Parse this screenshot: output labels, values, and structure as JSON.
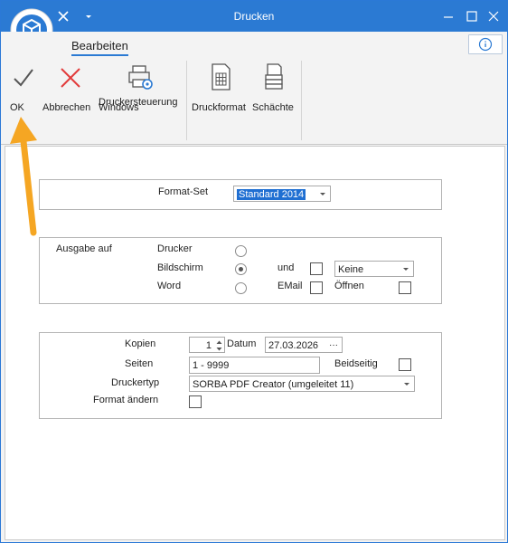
{
  "window": {
    "title": "Drucken"
  },
  "ribbon": {
    "tab": "Bearbeiten",
    "buttons": {
      "ok": "OK",
      "cancel": "Abbrechen",
      "windows_printer_line1": "Windows",
      "windows_printer_line2": "Druckersteuerung",
      "print_format": "Druckformat",
      "trays": "Schächte"
    }
  },
  "format_group": {
    "label": "Format-Set",
    "value": "Standard 2014"
  },
  "output_group": {
    "label": "Ausgabe auf",
    "options": [
      "Drucker",
      "Bildschirm",
      "Word"
    ],
    "selected": "Bildschirm",
    "and_label": "und",
    "email_label": "EMail",
    "open_label": "Öffnen",
    "target_value": "Keine"
  },
  "print_group": {
    "copies_label": "Kopien",
    "copies_value": "1",
    "date_label": "Datum",
    "date_value": "27.03.2026",
    "date_button": "···",
    "pages_label": "Seiten",
    "pages_value": "1 - 9999",
    "duplex_label": "Beidseitig",
    "printer_type_label": "Druckertyp",
    "printer_type_value": "SORBA PDF Creator (umgeleitet 11)",
    "change_format_label": "Format ändern"
  },
  "colors": {
    "titlebar": "#2b7ad3",
    "accent_arrow": "#f5a623",
    "selection": "#1f6fd2"
  }
}
